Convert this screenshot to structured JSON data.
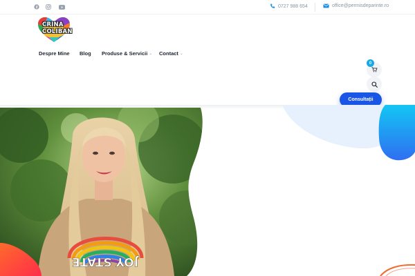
{
  "topbar": {
    "social": [
      "facebook-icon",
      "instagram-icon",
      "youtube-icon"
    ],
    "phone": "0727 988 654",
    "email": "office@permisdeparinte.ro"
  },
  "logo": {
    "line1": "CRINA",
    "line2": "COLIBAN"
  },
  "nav": {
    "items": [
      {
        "label": "Despre Mine",
        "has_dropdown": false
      },
      {
        "label": "Blog",
        "has_dropdown": false
      },
      {
        "label": "Produse & Servicii",
        "has_dropdown": true
      },
      {
        "label": "Contact",
        "has_dropdown": true
      }
    ]
  },
  "cart": {
    "count": "0"
  },
  "cta": {
    "label": "Consultații"
  },
  "hero": {
    "sweater_text": "JOY STATE"
  },
  "colors": {
    "accent_blue": "#1a56e6",
    "badge_cyan": "#16a9e6",
    "blob_light": "#e6f1fd",
    "blob_gradient_start": "#2f8ff6",
    "blob_gradient_end": "#13c6f3",
    "orange_red": "#ff4a2c"
  }
}
